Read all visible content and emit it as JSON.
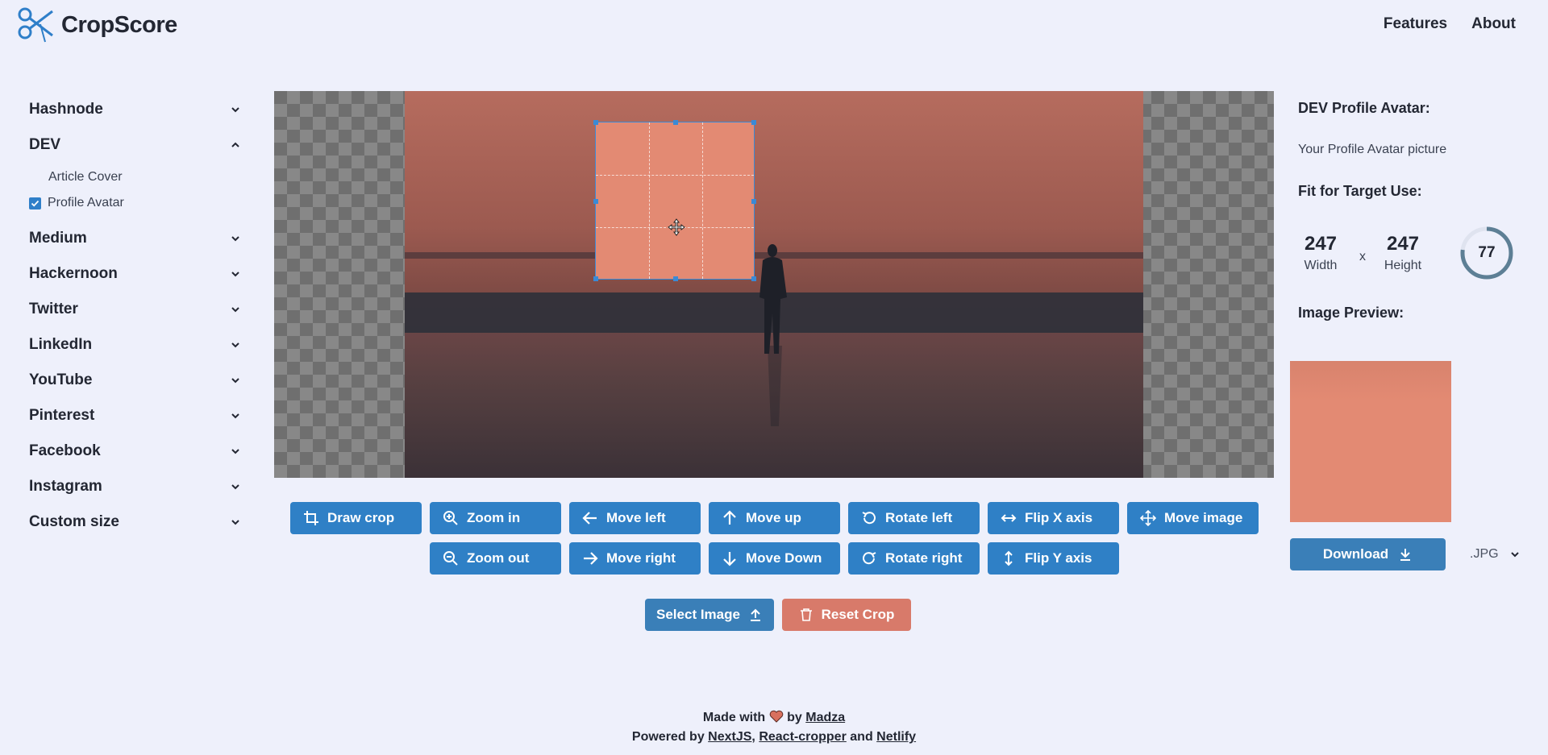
{
  "app": {
    "name": "CropScore"
  },
  "nav": {
    "features": "Features",
    "about": "About"
  },
  "sidebar": {
    "items": [
      {
        "label": "Hashnode",
        "expanded": false
      },
      {
        "label": "DEV",
        "expanded": true,
        "sub": [
          {
            "label": "Article Cover",
            "checked": false
          },
          {
            "label": "Profile Avatar",
            "checked": true
          }
        ]
      },
      {
        "label": "Medium",
        "expanded": false
      },
      {
        "label": "Hackernoon",
        "expanded": false
      },
      {
        "label": "Twitter",
        "expanded": false
      },
      {
        "label": "LinkedIn",
        "expanded": false
      },
      {
        "label": "YouTube",
        "expanded": false
      },
      {
        "label": "Pinterest",
        "expanded": false
      },
      {
        "label": "Facebook",
        "expanded": false
      },
      {
        "label": "Instagram",
        "expanded": false
      },
      {
        "label": "Custom size",
        "expanded": false
      }
    ]
  },
  "toolbar": {
    "draw_crop": "Draw crop",
    "zoom_in": "Zoom in",
    "move_left": "Move left",
    "move_up": "Move up",
    "rotate_left": "Rotate left",
    "flip_x": "Flip X axis",
    "move_image": "Move image",
    "zoom_out": "Zoom out",
    "move_right": "Move right",
    "move_down": "Move Down",
    "rotate_right": "Rotate right",
    "flip_y": "Flip Y axis"
  },
  "actions": {
    "select_image": "Select Image",
    "reset_crop": "Reset Crop"
  },
  "panel": {
    "title": "DEV Profile Avatar:",
    "description": "Your Profile Avatar picture",
    "fit_title": "Fit for Target Use:",
    "width_value": "247",
    "width_label": "Width",
    "x_sep": "x",
    "height_value": "247",
    "height_label": "Height",
    "score": "77",
    "score_fraction": 0.77,
    "preview_title": "Image Preview:",
    "download": "Download",
    "format": ".JPG"
  },
  "footer": {
    "made_with": "Made with",
    "by": "by",
    "author": "Madza",
    "powered_by": "Powered by",
    "tech1": "NextJS",
    "comma": ",",
    "tech2": "React-cropper",
    "and": "and",
    "tech3": "Netlify"
  },
  "colors": {
    "background": "#eef0fb",
    "primary_button": "#2f80c6",
    "select_button": "#3a7fb8",
    "reset_button": "#d87a6a",
    "crop_fill": "#e38a73",
    "score_ring": "#5d7f95"
  }
}
